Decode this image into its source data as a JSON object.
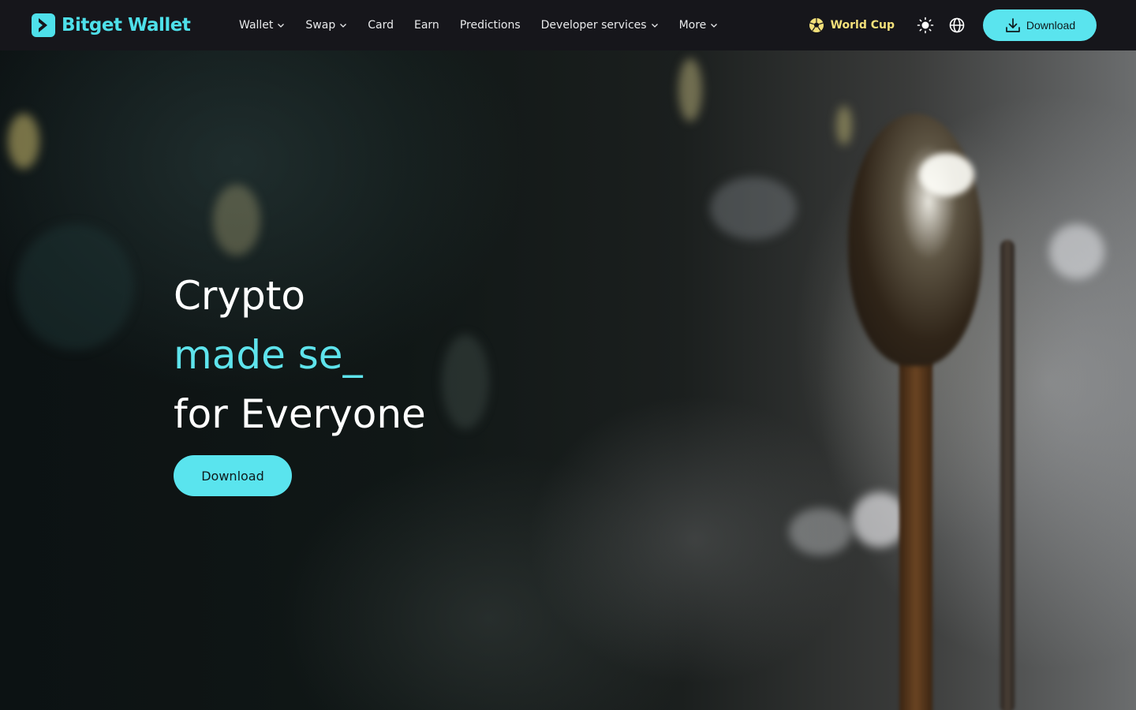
{
  "brand": {
    "name": "Bitget Wallet",
    "accent_color": "#5ae4ee"
  },
  "nav": {
    "items": [
      {
        "label": "Wallet",
        "has_dropdown": true
      },
      {
        "label": "Swap",
        "has_dropdown": true
      },
      {
        "label": "Card",
        "has_dropdown": false
      },
      {
        "label": "Earn",
        "has_dropdown": false
      },
      {
        "label": "Predictions",
        "has_dropdown": false
      },
      {
        "label": "Developer services",
        "has_dropdown": true
      },
      {
        "label": "More",
        "has_dropdown": true
      }
    ]
  },
  "header_tools": {
    "world_cup_label": "World Cup",
    "world_cup_color": "#f3e07a",
    "theme_icon": "sun-icon",
    "language_icon": "globe-icon",
    "download_label": "Download"
  },
  "hero": {
    "line1": "Crypto",
    "line2": "made se",
    "cursor": "_",
    "line3": "for Everyone",
    "download_label": "Download"
  }
}
